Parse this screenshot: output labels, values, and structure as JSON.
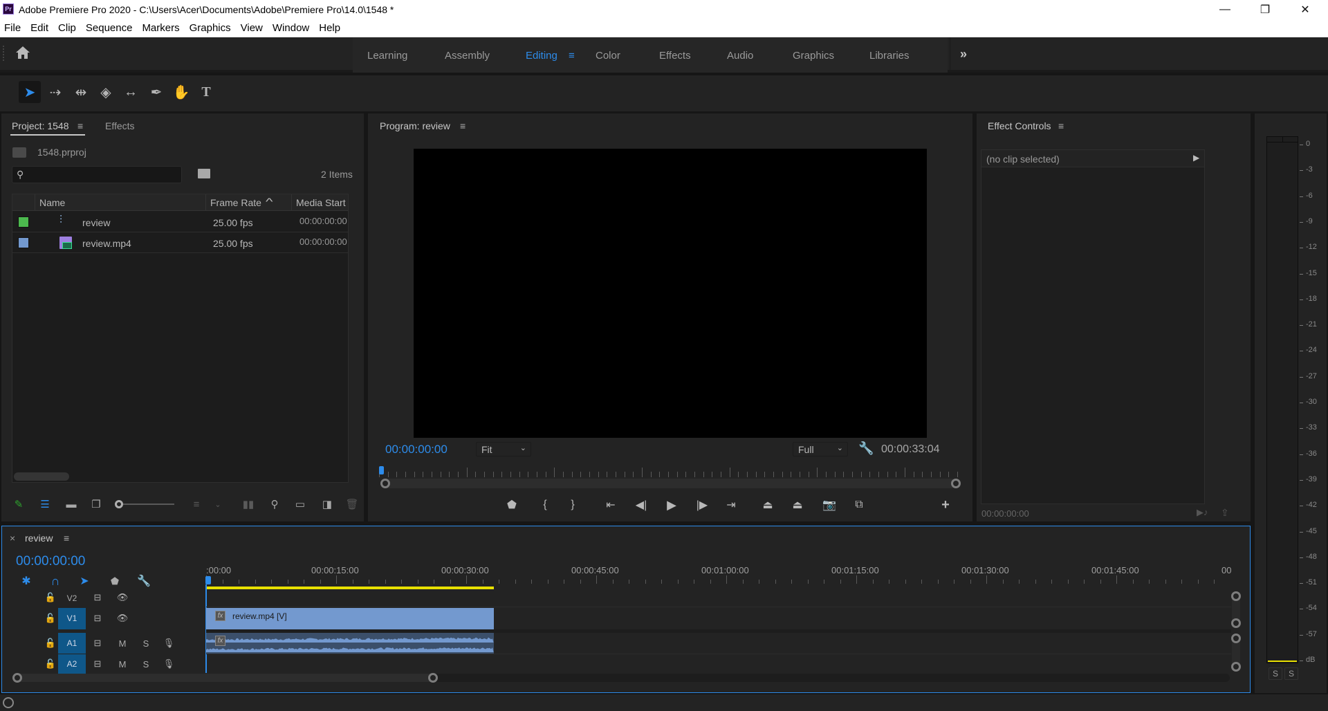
{
  "window": {
    "app_icon": "Pr",
    "title": "Adobe Premiere Pro 2020 - C:\\Users\\Acer\\Documents\\Adobe\\Premiere Pro\\14.0\\1548 *",
    "minimize": "—",
    "restore": "❐",
    "close": "✕"
  },
  "menu": [
    "File",
    "Edit",
    "Clip",
    "Sequence",
    "Markers",
    "Graphics",
    "View",
    "Window",
    "Help"
  ],
  "workspaces": {
    "items": [
      "Learning",
      "Assembly",
      "Editing",
      "Color",
      "Effects",
      "Audio",
      "Graphics",
      "Libraries"
    ],
    "active": "Editing",
    "active_menu_icon": "≡",
    "overflow_icon": "»"
  },
  "tools": [
    {
      "name": "selection-tool-icon",
      "glyph": "➤"
    },
    {
      "name": "track-select-forward-tool-icon",
      "glyph": "⇢"
    },
    {
      "name": "ripple-edit-tool-icon",
      "glyph": "⇹"
    },
    {
      "name": "razor-tool-icon",
      "glyph": "◈"
    },
    {
      "name": "slip-tool-icon",
      "glyph": "↔"
    },
    {
      "name": "pen-tool-icon",
      "glyph": "✒"
    },
    {
      "name": "hand-tool-icon",
      "glyph": "✋"
    },
    {
      "name": "type-tool-icon",
      "glyph": "T"
    }
  ],
  "project": {
    "tab_label": "Project: 1548",
    "effects_tab": "Effects",
    "menu_icon": "≡",
    "file_name": "1548.prproj",
    "search_placeholder": "",
    "item_count": "2 Items",
    "columns": [
      "Name",
      "Frame Rate",
      "Media Start"
    ],
    "sort_icon": "^",
    "rows": [
      {
        "color": "#4cb94e",
        "name": "review",
        "frame_rate": "25.00 fps",
        "media_start": "00:00:00:00",
        "type": "sequence"
      },
      {
        "color": "#7399cf",
        "name": "review.mp4",
        "frame_rate": "25.00 fps",
        "media_start": "00:00:00:00",
        "type": "clip"
      }
    ]
  },
  "program": {
    "title": "Program: review",
    "menu_icon": "≡",
    "timecode": "00:00:00:00",
    "zoom": "Fit",
    "resolution": "Full",
    "duration": "00:00:33:04",
    "playhead_position": 0
  },
  "effect_controls": {
    "title": "Effect Controls",
    "menu_icon": "≡",
    "no_clip": "(no clip selected)",
    "timecode": "00:00:00:00"
  },
  "audio_meter": {
    "labels": [
      "0",
      "-3",
      "-6",
      "-9",
      "-12",
      "-15",
      "-18",
      "-21",
      "-24",
      "-27",
      "-30",
      "-33",
      "-36",
      "-39",
      "-42",
      "-45",
      "-48",
      "-51",
      "-54",
      "-57",
      "dB"
    ],
    "solo_left": "S",
    "solo_right": "S",
    "level_color": "#e8e000"
  },
  "timeline": {
    "sequence_name": "review",
    "close_icon": "×",
    "menu_icon": "≡",
    "timecode": "00:00:00:00",
    "ruler_labels": [
      ":00:00",
      "00:00:15:00",
      "00:00:30:00",
      "00:00:45:00",
      "00:01:00:00",
      "00:01:15:00",
      "00:01:30:00",
      "00:01:45:00",
      "00"
    ],
    "work_area_end_seconds": 33.16,
    "tracks": [
      {
        "id": "V2",
        "targeted": false,
        "type": "video"
      },
      {
        "id": "V1",
        "targeted": true,
        "type": "video"
      },
      {
        "id": "A1",
        "targeted": true,
        "type": "audio",
        "mute": "M",
        "solo": "S"
      },
      {
        "id": "A2",
        "targeted": true,
        "type": "audio",
        "mute": "M",
        "solo": "S"
      }
    ],
    "clips": [
      {
        "track": "V1",
        "label": "review.mp4 [V]",
        "fx": "fx",
        "start_seconds": 0,
        "end_seconds": 33.16
      },
      {
        "track": "A1",
        "label": "",
        "fx": "fx",
        "start_seconds": 0,
        "end_seconds": 33.16
      }
    ],
    "clip_color": "#7399cf",
    "accent": "#2d8ceb"
  },
  "colors": {
    "accent_blue": "#2d8ceb",
    "panel_bg": "#232323",
    "app_bg": "#161616"
  }
}
